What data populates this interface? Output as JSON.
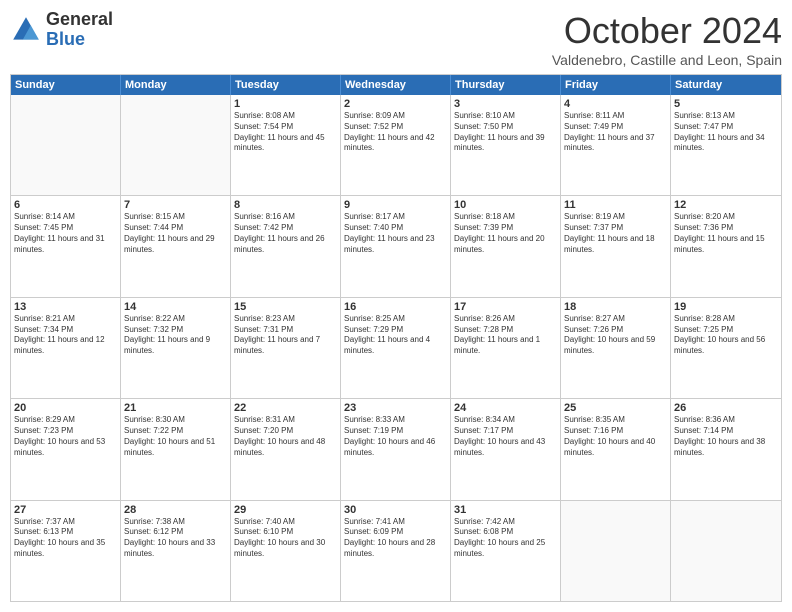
{
  "header": {
    "logo_general": "General",
    "logo_blue": "Blue",
    "month_title": "October 2024",
    "subtitle": "Valdenebro, Castille and Leon, Spain"
  },
  "days_of_week": [
    "Sunday",
    "Monday",
    "Tuesday",
    "Wednesday",
    "Thursday",
    "Friday",
    "Saturday"
  ],
  "rows": [
    [
      {
        "day": "",
        "info": ""
      },
      {
        "day": "",
        "info": ""
      },
      {
        "day": "1",
        "info": "Sunrise: 8:08 AM\nSunset: 7:54 PM\nDaylight: 11 hours and 45 minutes."
      },
      {
        "day": "2",
        "info": "Sunrise: 8:09 AM\nSunset: 7:52 PM\nDaylight: 11 hours and 42 minutes."
      },
      {
        "day": "3",
        "info": "Sunrise: 8:10 AM\nSunset: 7:50 PM\nDaylight: 11 hours and 39 minutes."
      },
      {
        "day": "4",
        "info": "Sunrise: 8:11 AM\nSunset: 7:49 PM\nDaylight: 11 hours and 37 minutes."
      },
      {
        "day": "5",
        "info": "Sunrise: 8:13 AM\nSunset: 7:47 PM\nDaylight: 11 hours and 34 minutes."
      }
    ],
    [
      {
        "day": "6",
        "info": "Sunrise: 8:14 AM\nSunset: 7:45 PM\nDaylight: 11 hours and 31 minutes."
      },
      {
        "day": "7",
        "info": "Sunrise: 8:15 AM\nSunset: 7:44 PM\nDaylight: 11 hours and 29 minutes."
      },
      {
        "day": "8",
        "info": "Sunrise: 8:16 AM\nSunset: 7:42 PM\nDaylight: 11 hours and 26 minutes."
      },
      {
        "day": "9",
        "info": "Sunrise: 8:17 AM\nSunset: 7:40 PM\nDaylight: 11 hours and 23 minutes."
      },
      {
        "day": "10",
        "info": "Sunrise: 8:18 AM\nSunset: 7:39 PM\nDaylight: 11 hours and 20 minutes."
      },
      {
        "day": "11",
        "info": "Sunrise: 8:19 AM\nSunset: 7:37 PM\nDaylight: 11 hours and 18 minutes."
      },
      {
        "day": "12",
        "info": "Sunrise: 8:20 AM\nSunset: 7:36 PM\nDaylight: 11 hours and 15 minutes."
      }
    ],
    [
      {
        "day": "13",
        "info": "Sunrise: 8:21 AM\nSunset: 7:34 PM\nDaylight: 11 hours and 12 minutes."
      },
      {
        "day": "14",
        "info": "Sunrise: 8:22 AM\nSunset: 7:32 PM\nDaylight: 11 hours and 9 minutes."
      },
      {
        "day": "15",
        "info": "Sunrise: 8:23 AM\nSunset: 7:31 PM\nDaylight: 11 hours and 7 minutes."
      },
      {
        "day": "16",
        "info": "Sunrise: 8:25 AM\nSunset: 7:29 PM\nDaylight: 11 hours and 4 minutes."
      },
      {
        "day": "17",
        "info": "Sunrise: 8:26 AM\nSunset: 7:28 PM\nDaylight: 11 hours and 1 minute."
      },
      {
        "day": "18",
        "info": "Sunrise: 8:27 AM\nSunset: 7:26 PM\nDaylight: 10 hours and 59 minutes."
      },
      {
        "day": "19",
        "info": "Sunrise: 8:28 AM\nSunset: 7:25 PM\nDaylight: 10 hours and 56 minutes."
      }
    ],
    [
      {
        "day": "20",
        "info": "Sunrise: 8:29 AM\nSunset: 7:23 PM\nDaylight: 10 hours and 53 minutes."
      },
      {
        "day": "21",
        "info": "Sunrise: 8:30 AM\nSunset: 7:22 PM\nDaylight: 10 hours and 51 minutes."
      },
      {
        "day": "22",
        "info": "Sunrise: 8:31 AM\nSunset: 7:20 PM\nDaylight: 10 hours and 48 minutes."
      },
      {
        "day": "23",
        "info": "Sunrise: 8:33 AM\nSunset: 7:19 PM\nDaylight: 10 hours and 46 minutes."
      },
      {
        "day": "24",
        "info": "Sunrise: 8:34 AM\nSunset: 7:17 PM\nDaylight: 10 hours and 43 minutes."
      },
      {
        "day": "25",
        "info": "Sunrise: 8:35 AM\nSunset: 7:16 PM\nDaylight: 10 hours and 40 minutes."
      },
      {
        "day": "26",
        "info": "Sunrise: 8:36 AM\nSunset: 7:14 PM\nDaylight: 10 hours and 38 minutes."
      }
    ],
    [
      {
        "day": "27",
        "info": "Sunrise: 7:37 AM\nSunset: 6:13 PM\nDaylight: 10 hours and 35 minutes."
      },
      {
        "day": "28",
        "info": "Sunrise: 7:38 AM\nSunset: 6:12 PM\nDaylight: 10 hours and 33 minutes."
      },
      {
        "day": "29",
        "info": "Sunrise: 7:40 AM\nSunset: 6:10 PM\nDaylight: 10 hours and 30 minutes."
      },
      {
        "day": "30",
        "info": "Sunrise: 7:41 AM\nSunset: 6:09 PM\nDaylight: 10 hours and 28 minutes."
      },
      {
        "day": "31",
        "info": "Sunrise: 7:42 AM\nSunset: 6:08 PM\nDaylight: 10 hours and 25 minutes."
      },
      {
        "day": "",
        "info": ""
      },
      {
        "day": "",
        "info": ""
      }
    ]
  ]
}
